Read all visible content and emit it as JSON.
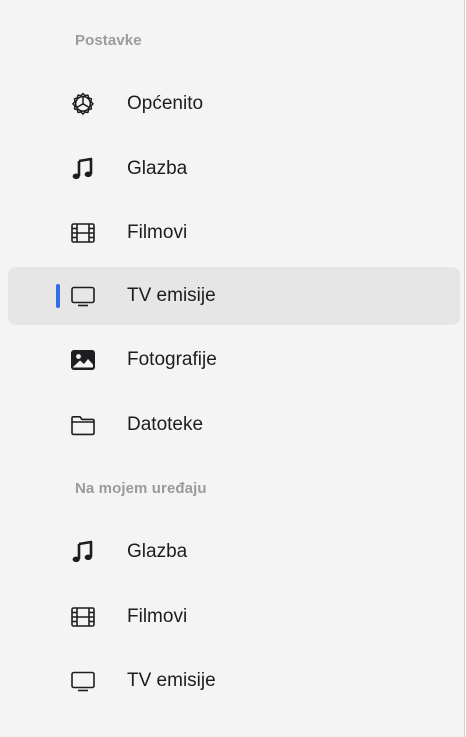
{
  "sections": {
    "settings": {
      "header": "Postavke",
      "items": [
        {
          "label": "Općenito",
          "icon": "gear-icon"
        },
        {
          "label": "Glazba",
          "icon": "music-note-icon"
        },
        {
          "label": "Filmovi",
          "icon": "film-icon"
        },
        {
          "label": "TV emisije",
          "icon": "tv-icon",
          "selected": true
        },
        {
          "label": "Fotografije",
          "icon": "photo-icon"
        },
        {
          "label": "Datoteke",
          "icon": "folder-icon"
        }
      ]
    },
    "device": {
      "header": "Na mojem uređaju",
      "items": [
        {
          "label": "Glazba",
          "icon": "music-note-icon"
        },
        {
          "label": "Filmovi",
          "icon": "film-icon"
        },
        {
          "label": "TV emisije",
          "icon": "tv-icon"
        }
      ]
    }
  },
  "colors": {
    "accent": "#2f6ee5",
    "selected_background": "#e6e6e6",
    "sidebar_background": "#f4f4f4",
    "header_text": "#9b9b9b"
  }
}
